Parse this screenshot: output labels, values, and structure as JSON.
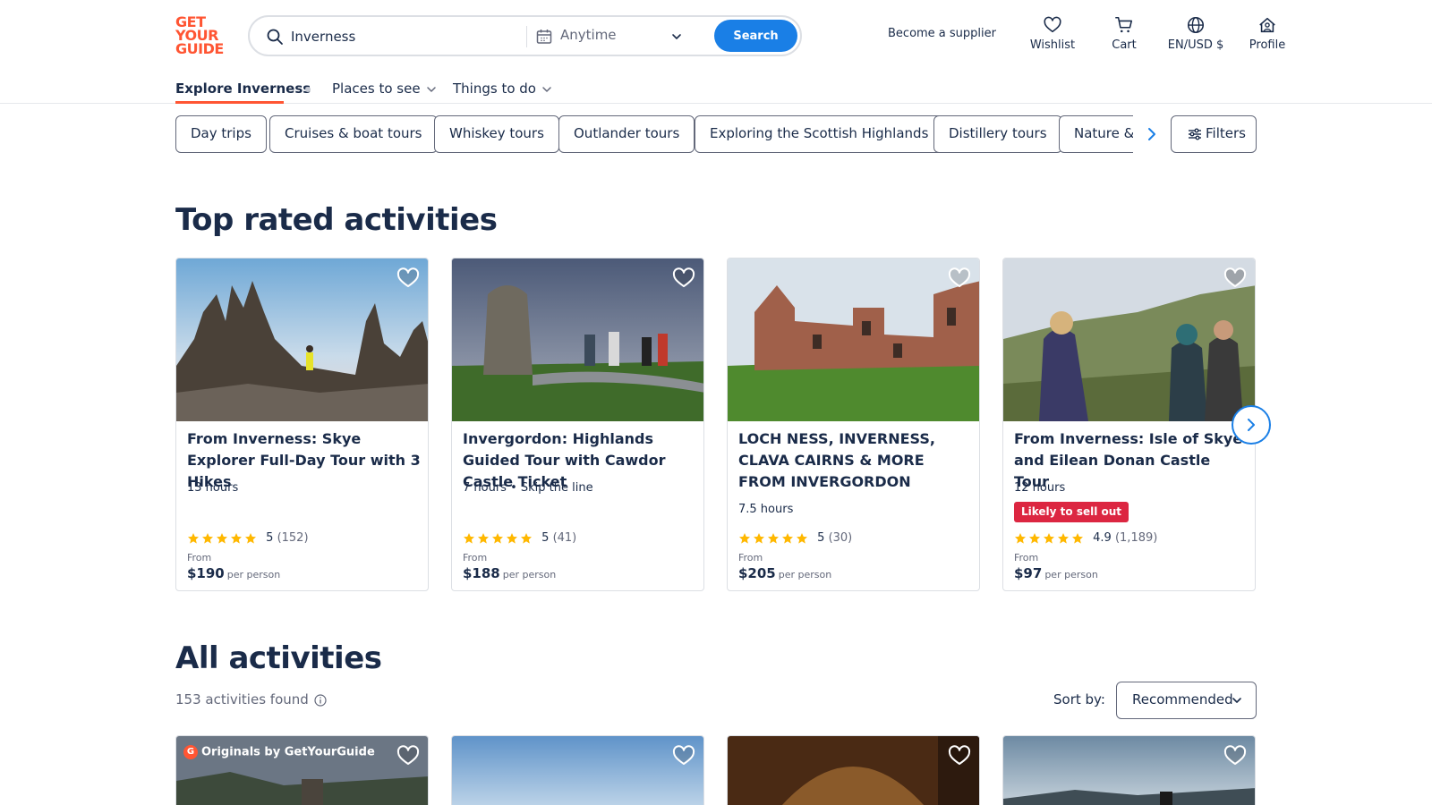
{
  "brand": {
    "logo_line1": "GET",
    "logo_line2": "YOUR",
    "logo_line3": "GUIDE",
    "color": "#ff5533"
  },
  "search": {
    "value": "Inverness",
    "date_label": "Anytime",
    "button_label": "Search"
  },
  "header_nav": {
    "supplier": "Become a supplier",
    "wishlist": "Wishlist",
    "cart": "Cart",
    "locale": "EN/USD $",
    "profile": "Profile"
  },
  "subnav": {
    "explore": "Explore Inverness",
    "places": "Places to see",
    "things": "Things to do"
  },
  "chips": [
    "Day trips",
    "Cruises & boat tours",
    "Whiskey tours",
    "Outlander tours",
    "Exploring the Scottish Highlands",
    "Distillery tours",
    "Nature & wildlife"
  ],
  "filters_label": "Filters",
  "top_rated": {
    "title": "Top rated activities",
    "cards": [
      {
        "title": "From Inverness: Skye Explorer Full-Day Tour with 3 Hikes",
        "meta": "13 hours",
        "badge": "",
        "rating": "5",
        "count": "(152)",
        "from": "From",
        "price": "$190",
        "per": "per person"
      },
      {
        "title": "Invergordon: Highlands Guided Tour with Cawdor Castle Ticket",
        "meta": "7 hours • Skip the line",
        "badge": "",
        "rating": "5",
        "count": "(41)",
        "from": "From",
        "price": "$188",
        "per": "per person"
      },
      {
        "title": "LOCH NESS, INVERNESS, CLAVA CAIRNS & MORE FROM INVERGORDON",
        "meta": "7.5 hours",
        "badge": "",
        "rating": "5",
        "count": "(30)",
        "from": "From",
        "price": "$205",
        "per": "per person"
      },
      {
        "title": "From Inverness: Isle of Skye and Eilean Donan Castle Tour",
        "meta": "12 hours",
        "badge": "Likely to sell out",
        "rating": "4.9",
        "count": "(1,189)",
        "from": "From",
        "price": "$97",
        "per": "per person"
      }
    ]
  },
  "all_activities": {
    "title": "All activities",
    "found": "153 activities found",
    "sort_label": "Sort by:",
    "sort_value": "Recommended",
    "originals_label": "Originals by GetYourGuide",
    "originals_g": "G"
  },
  "colors": {
    "primary": "#1a7fe6",
    "text": "#1a2b49",
    "badge": "#dc2641",
    "star": "#ffb800",
    "accent": "#ff5533"
  },
  "icons": [
    "search-icon",
    "calendar-icon",
    "chevron-down-icon",
    "heart-icon",
    "cart-icon",
    "globe-icon",
    "profile-icon",
    "chevron-right-icon",
    "filters-icon",
    "info-icon",
    "star-icon"
  ]
}
